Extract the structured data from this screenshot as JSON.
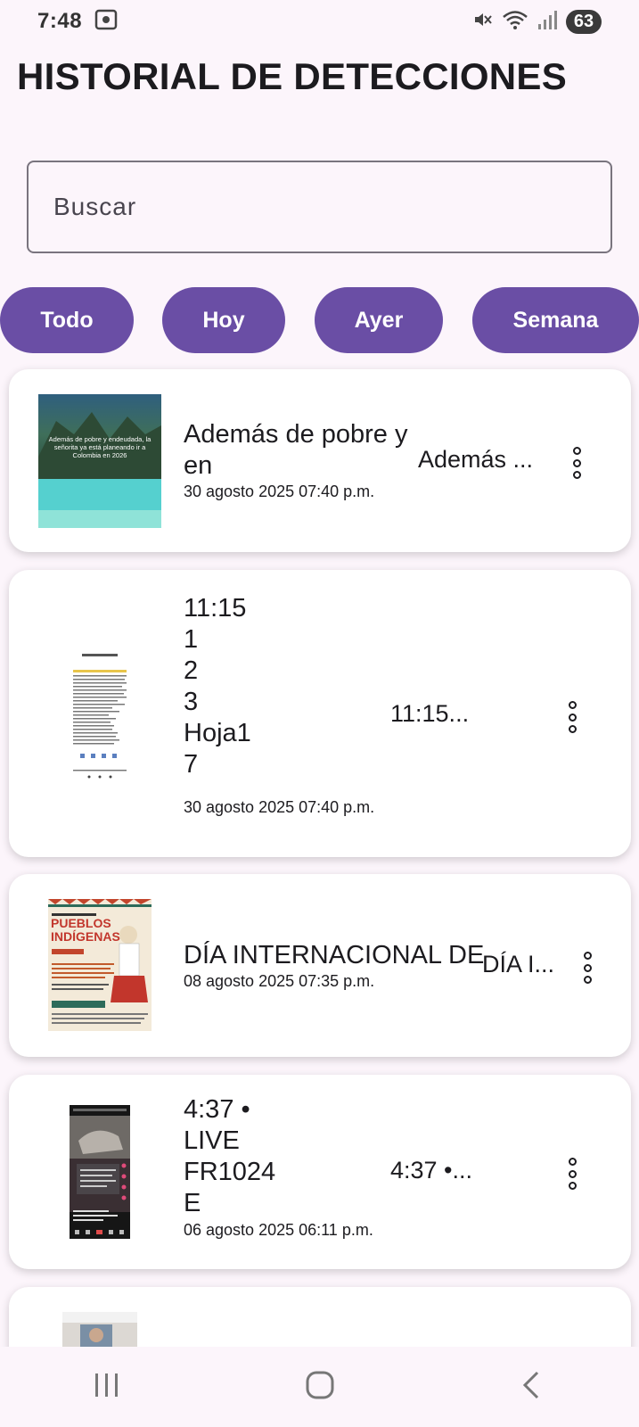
{
  "status": {
    "time": "7:48",
    "battery": "63"
  },
  "header": {
    "title": "HISTORIAL DE DETECCIONES"
  },
  "search": {
    "placeholder": "Buscar"
  },
  "filters": [
    "Todo",
    "Hoy",
    "Ayer",
    "Semana"
  ],
  "thumbnail_texts": {
    "beach": "Además de pobre y endeudada, la señorita ya está planeando ir a Colombia en 2026",
    "poster": "PUEBLOS INDÍGENAS"
  },
  "items": [
    {
      "title": "Además de pobre y\nen",
      "date": "30 agosto 2025 07:40 p.m.",
      "snippet": "Además ..."
    },
    {
      "title": "11:15\n1\n2\n3\nHoja1\n7",
      "date": "30 agosto 2025 07:40 p.m.",
      "snippet": "11:15..."
    },
    {
      "title": "DÍA INTERNACIONAL DE",
      "date": "08 agosto 2025 07:35 p.m.",
      "snippet": "DÍA I..."
    },
    {
      "title": "4:37 •\nLIVE\nFR1024\nE",
      "date": "06 agosto 2025 06:11 p.m.",
      "snippet": "4:37 •..."
    }
  ]
}
